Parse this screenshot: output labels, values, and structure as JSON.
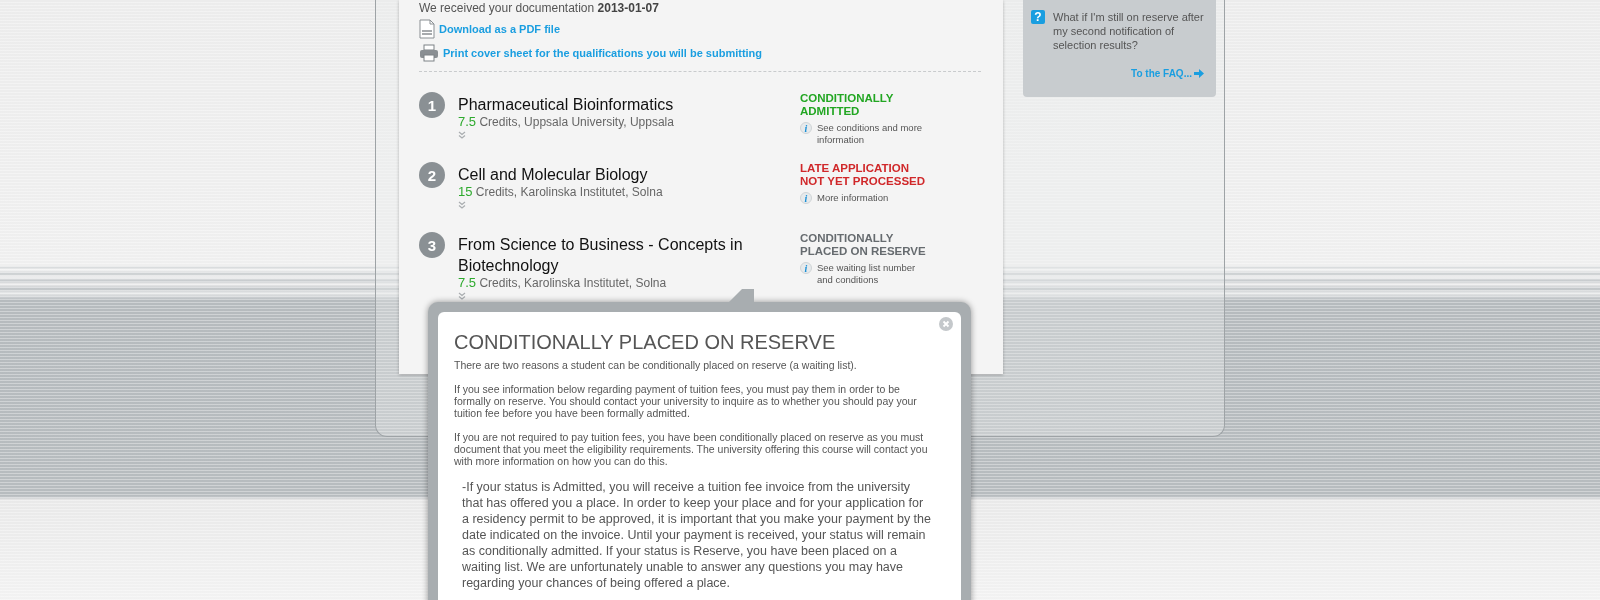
{
  "documentation": {
    "label": "We received your documentation",
    "date": "2013-01-07"
  },
  "links": [
    {
      "kind": "pdf",
      "label": "Download as a PDF file"
    },
    {
      "kind": "print",
      "label": "Print cover sheet for the qualifications you will be submitting"
    }
  ],
  "courses": [
    {
      "number": "1",
      "title": "Pharmaceutical Bioinformatics",
      "credits": "7.5",
      "details": "Credits, Uppsala University, Uppsala",
      "status": {
        "kind": "admitted",
        "label": "CONDITIONALLY ADMITTED"
      },
      "info_icon": "i",
      "info": "See conditions and more information"
    },
    {
      "number": "2",
      "title": "Cell and Molecular Biology",
      "credits": "15",
      "details": "Credits, Karolinska Institutet, Solna",
      "status": {
        "kind": "late",
        "label": "LATE APPLICATION NOT YET PROCESSED"
      },
      "info_icon": "i",
      "info": "More information"
    },
    {
      "number": "3",
      "title": "From Science to Business - Concepts in Biotechnology",
      "credits": "7.5",
      "details": "Credits, Karolinska Institutet, Solna",
      "status": {
        "kind": "reserve",
        "label": "CONDITIONALLY PLACED ON RESERVE"
      },
      "info_icon": "i",
      "info": "See waiting list number and conditions"
    }
  ],
  "faq": {
    "icon": "?",
    "question": "What if I'm still on reserve after my second notification of selection results?",
    "link": "To the FAQ..."
  },
  "popup": {
    "title": "CONDITIONALLY PLACED ON RESERVE",
    "paragraphs": [
      "There are two reasons a student can be conditionally placed on reserve (a waiting list).",
      "If you see information below regarding payment of tuition fees, you must pay them in order to be formally on reserve. You should contact your university to inquire as to whether you should pay your tuition fee before you have been formally admitted.",
      "If you are not required to pay tuition fees, you have been conditionally placed on reserve as you must document that you meet the eligibility requirements. The university offering this course will contact you with more information on how you can do this."
    ],
    "note": "-If your status is Admitted, you will receive a tuition fee invoice from the university that has offered you a place. In order to keep your place and for your application for a residency permit to be approved, it is important that you make your payment by the date indicated on the invoice. Until your payment is received, your status will remain as conditionally admitted. If your status is Reserve, you have been placed on a waiting list. We are unfortunately unable to answer any questions you may have regarding your chances of being offered a place."
  }
}
